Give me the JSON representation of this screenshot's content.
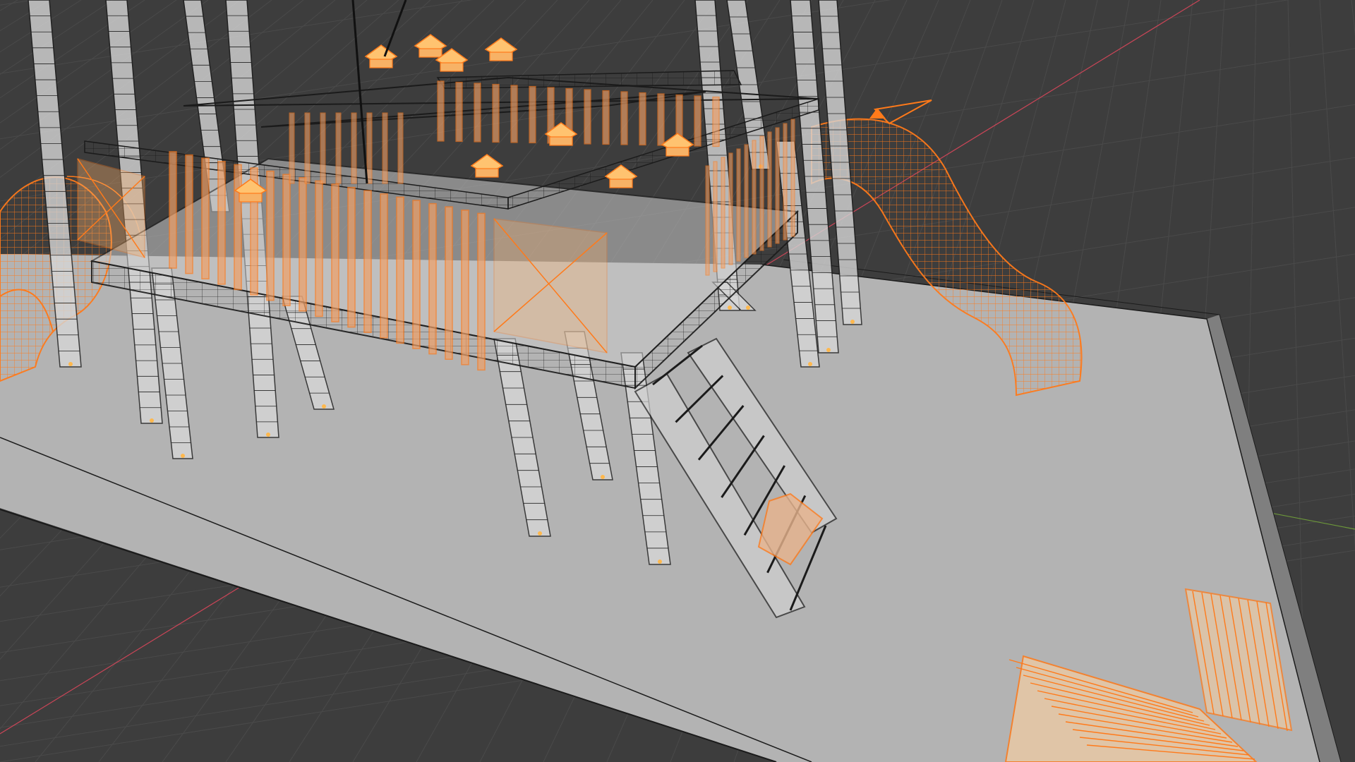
{
  "viewport": {
    "view": "3D Viewport",
    "shading": "wireframe-xray",
    "background_color": "#3d3d3d",
    "grid_line_color": "#4a4a4a",
    "x_axis_color": "#d9465a",
    "y_axis_color": "#72a23a",
    "selection_color": "#ff7a1a",
    "active_color": "#ffb84d",
    "wire_color": "#101010"
  },
  "scene": {
    "objects": [
      {
        "name": "ground-slab",
        "kind": "box",
        "selected": false
      },
      {
        "name": "platform-frame",
        "kind": "mesh",
        "selected": false
      },
      {
        "name": "support-posts",
        "kind": "mesh",
        "selected": false
      },
      {
        "name": "railing-balusters",
        "kind": "mesh",
        "selected": true
      },
      {
        "name": "post-caps",
        "kind": "mesh",
        "selected": true
      },
      {
        "name": "spiral-tube-slide",
        "kind": "mesh",
        "selected": true
      },
      {
        "name": "wave-slide",
        "kind": "mesh",
        "selected": true
      },
      {
        "name": "ladder",
        "kind": "mesh",
        "selected": false
      },
      {
        "name": "ladder-step-highlight",
        "kind": "face",
        "selected": true
      },
      {
        "name": "park-bench",
        "kind": "mesh",
        "selected": true
      },
      {
        "name": "camera",
        "kind": "camera",
        "selected": true
      },
      {
        "name": "swing-ropes",
        "kind": "curve",
        "selected": false
      }
    ]
  }
}
